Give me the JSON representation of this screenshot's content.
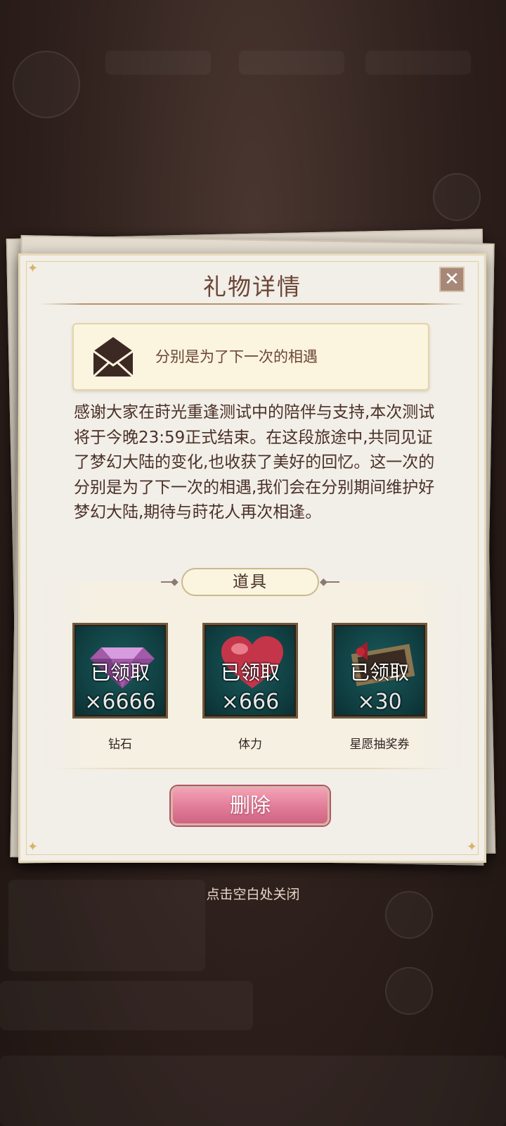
{
  "dialog": {
    "title": "礼物详情",
    "subject": "分别是为了下一次的相遇",
    "body": "感谢大家在莳光重逢测试中的陪伴与支持,本次测试将于今晚23:59正式结束。在这段旅途中,共同见证了梦幻大陆的变化,也收获了美好的回忆。这一次的分别是为了下一次的相遇,我们会在分别期间维护好梦幻大陆,期待与莳花人再次相逢。",
    "section_label": "道具",
    "items": [
      {
        "name": "钻石",
        "status": "已领取",
        "count": "×6666",
        "icon": "diamond-icon"
      },
      {
        "name": "体力",
        "status": "已领取",
        "count": "×666",
        "icon": "heart-icon"
      },
      {
        "name": "星愿抽奖券",
        "status": "已领取",
        "count": "×30",
        "icon": "ticket-icon"
      }
    ],
    "delete_label": "删除",
    "close_icon": "close-icon"
  },
  "hint": "点击空白处关闭",
  "colors": {
    "title": "#6b4636",
    "delete_button": "#e17b97",
    "item_frame": "#0f3d40"
  }
}
